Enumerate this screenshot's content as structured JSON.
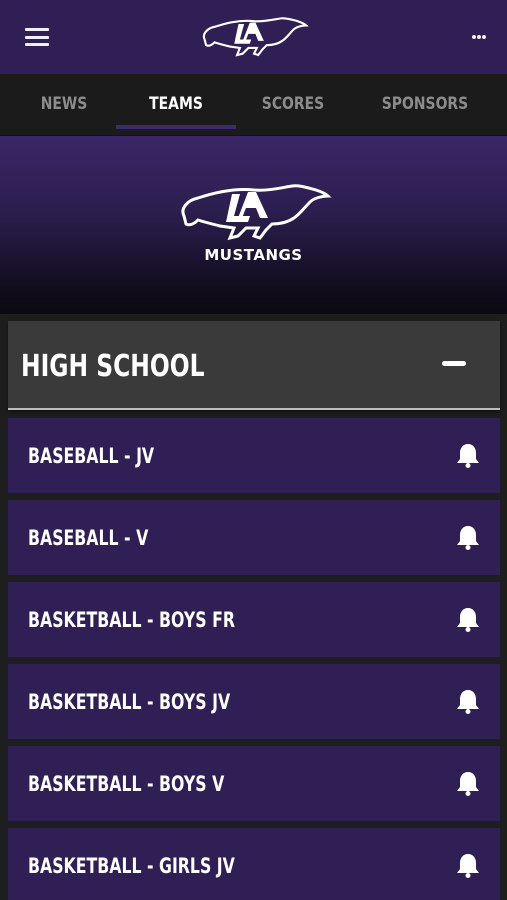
{
  "header": {
    "menu_icon": "hamburger-menu-icon",
    "logo": "la-mustang-logo",
    "more_icon": "more-vertical-icon"
  },
  "tabs": [
    {
      "label": "NEWS",
      "active": false
    },
    {
      "label": "TEAMS",
      "active": true
    },
    {
      "label": "SCORES",
      "active": false
    },
    {
      "label": "SPONSORS",
      "active": false
    }
  ],
  "hero": {
    "logo": "la-mustang-logo",
    "team_name": "MUSTANGS"
  },
  "section": {
    "title": "HIGH SCHOOL",
    "toggle_icon": "minus-icon"
  },
  "teams": [
    {
      "label": "BASEBALL - JV"
    },
    {
      "label": "BASEBALL - V"
    },
    {
      "label": "BASKETBALL - BOYS FR"
    },
    {
      "label": "BASKETBALL - BOYS JV"
    },
    {
      "label": "BASKETBALL - BOYS V"
    },
    {
      "label": "BASKETBALL - GIRLS JV"
    }
  ],
  "colors": {
    "brand_purple": "#2f1f54",
    "tab_bar": "#1b1b1b",
    "section_header": "#3a3a3a",
    "active_tab_text": "#ffffff",
    "inactive_tab_text": "#8c8c8c"
  }
}
